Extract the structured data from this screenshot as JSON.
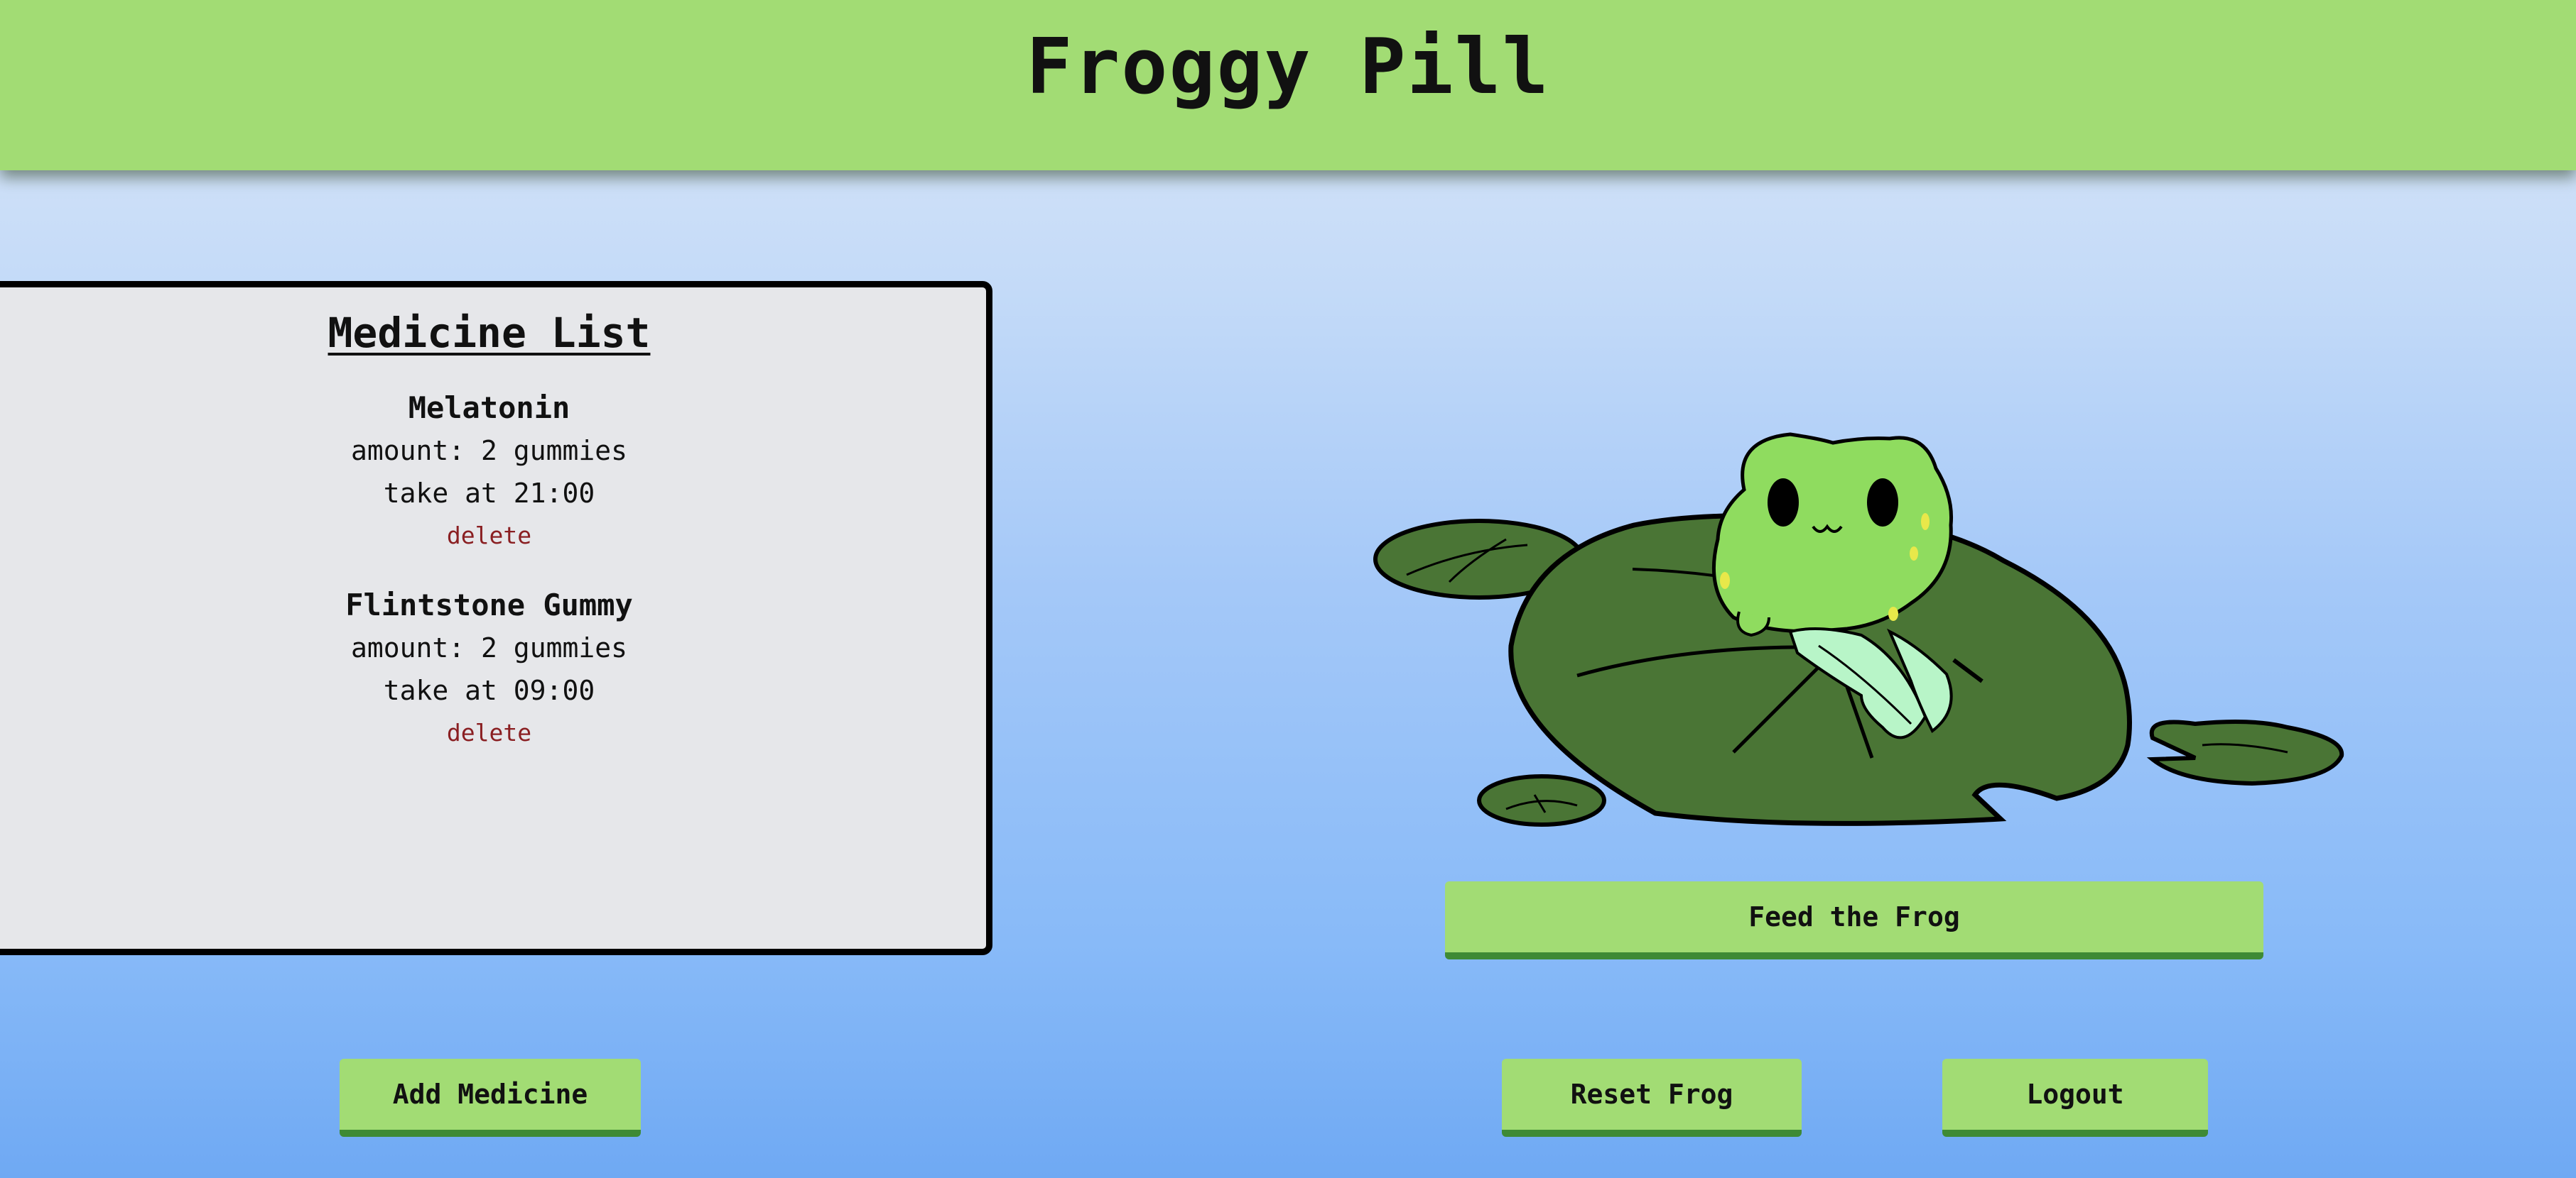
{
  "header": {
    "title": "Froggy Pill"
  },
  "medicine_list": {
    "title": "Medicine List",
    "items": [
      {
        "name": "Melatonin",
        "amount": "amount: 2 gummies",
        "time": "take at 21:00",
        "delete_label": "delete"
      },
      {
        "name": "Flintstone Gummy",
        "amount": "amount: 2 gummies",
        "time": "take at 09:00",
        "delete_label": "delete"
      }
    ]
  },
  "buttons": {
    "feed": "Feed the Frog",
    "add": "Add Medicine",
    "reset": "Reset Frog",
    "logout": "Logout"
  },
  "colors": {
    "header_bg": "#a2dc74",
    "button_bg": "#a2dc74",
    "button_border": "#3e8a35",
    "delete_link": "#8a1f22",
    "panel_bg": "#e6e7ea"
  },
  "icons": {
    "frog": "frog-illustration",
    "lilypad": "lily-pad-icon"
  }
}
